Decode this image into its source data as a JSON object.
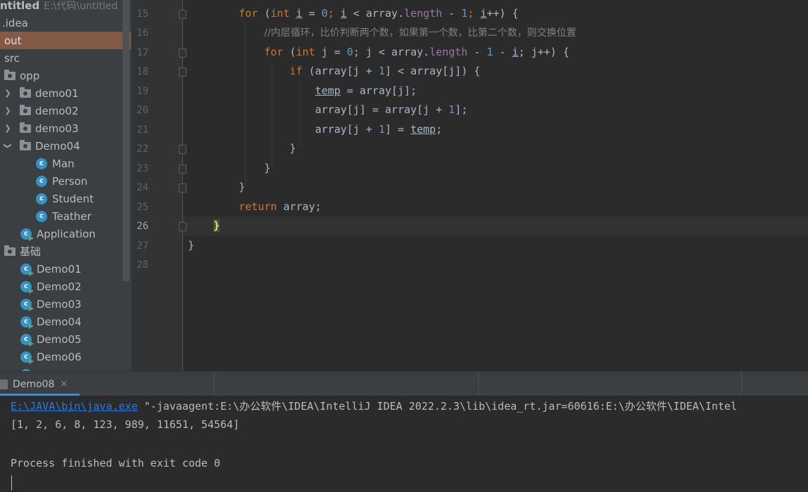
{
  "project_tree": {
    "root": {
      "label": "ntitled",
      "path": "E:\\代码\\untitled"
    },
    "items": [
      {
        "label": ".idea",
        "kind": "folder"
      },
      {
        "label": "out",
        "kind": "folder",
        "selected": true
      },
      {
        "label": "src",
        "kind": "folder"
      },
      {
        "label": "opp",
        "kind": "package"
      },
      {
        "label": "demo01",
        "kind": "package"
      },
      {
        "label": "demo02",
        "kind": "package"
      },
      {
        "label": "demo03",
        "kind": "package"
      },
      {
        "label": "Demo04",
        "kind": "package"
      },
      {
        "label": "Man",
        "kind": "class"
      },
      {
        "label": "Person",
        "kind": "class"
      },
      {
        "label": "Student",
        "kind": "class"
      },
      {
        "label": "Teather",
        "kind": "class"
      },
      {
        "label": "Application",
        "kind": "runnable-class"
      },
      {
        "label": "基础",
        "kind": "package"
      },
      {
        "label": "Demo01",
        "kind": "runnable-class"
      },
      {
        "label": "Demo02",
        "kind": "runnable-class"
      },
      {
        "label": "Demo03",
        "kind": "runnable-class"
      },
      {
        "label": "Demo04",
        "kind": "runnable-class"
      },
      {
        "label": "Demo05",
        "kind": "runnable-class"
      },
      {
        "label": "Demo06",
        "kind": "runnable-class"
      }
    ],
    "class_icon_letter": "c"
  },
  "editor": {
    "line_numbers": [
      "15",
      "16",
      "17",
      "18",
      "19",
      "20",
      "21",
      "22",
      "23",
      "24",
      "25",
      "26",
      "27",
      "28"
    ],
    "current_line": "26",
    "lines": {
      "l15": {
        "for": "for",
        "p1": " (",
        "int": "int",
        "sp": " ",
        "i": "i",
        "eq": " = ",
        "zero": "0",
        "semi1": "; ",
        "i2": "i",
        "lt": " < array.",
        "length": "length",
        "minus": " - ",
        "one": "1",
        "semi2": "; ",
        "i3": "i",
        "rest": "++) {"
      },
      "l16": {
        "comment": "//内层循环，比价判断两个数，如果第一个数，比第二个数，则交换位置"
      },
      "l17": {
        "for": "for",
        "p1": " (",
        "int": "int",
        "rest1": " j = ",
        "zero": "0",
        "semi1": "; j < array.",
        "length": "length",
        "minus": " - ",
        "one": "1",
        "minus2": " - ",
        "i": "i",
        "rest2": "; j++) {"
      },
      "l18": {
        "if": "if",
        "p1": " (array[j + ",
        "one": "1",
        "rest": "] < array[j]) {"
      },
      "l19": {
        "temp": "temp",
        "rest": " = array[j];"
      },
      "l20": {
        "a": "array[j] = array[j + ",
        "one": "1",
        "rest": "];"
      },
      "l21": {
        "a": "array[j + ",
        "one": "1",
        "mid": "] = ",
        "temp": "temp",
        "semi": ";"
      },
      "l22": {
        "text": "}"
      },
      "l23": {
        "text": "}"
      },
      "l24": {
        "text": "}"
      },
      "l25": {
        "return": "return",
        "rest": " array;"
      },
      "l26": {
        "text": "}"
      },
      "l27": {
        "text": "}"
      },
      "l28": {
        "text": ""
      }
    }
  },
  "run_panel": {
    "tab_label": "Demo08",
    "close_symbol": "×",
    "console": {
      "exe_link": "E:\\JAVA\\bin\\java.exe",
      "cmd_args": " \"-javaagent:E:\\办公软件\\IDEA\\IntelliJ IDEA 2022.2.3\\lib\\idea_rt.jar=60616:E:\\办公软件\\IDEA\\Intel",
      "output": "[1, 2, 6, 8, 123, 989, 11651, 54564]",
      "exit": "Process finished with exit code 0"
    }
  },
  "colors": {
    "keyword": "#cc7832",
    "number": "#6897bb",
    "field": "#9876aa",
    "comment": "#808080",
    "selection": "#845a45",
    "link": "#287bde"
  }
}
